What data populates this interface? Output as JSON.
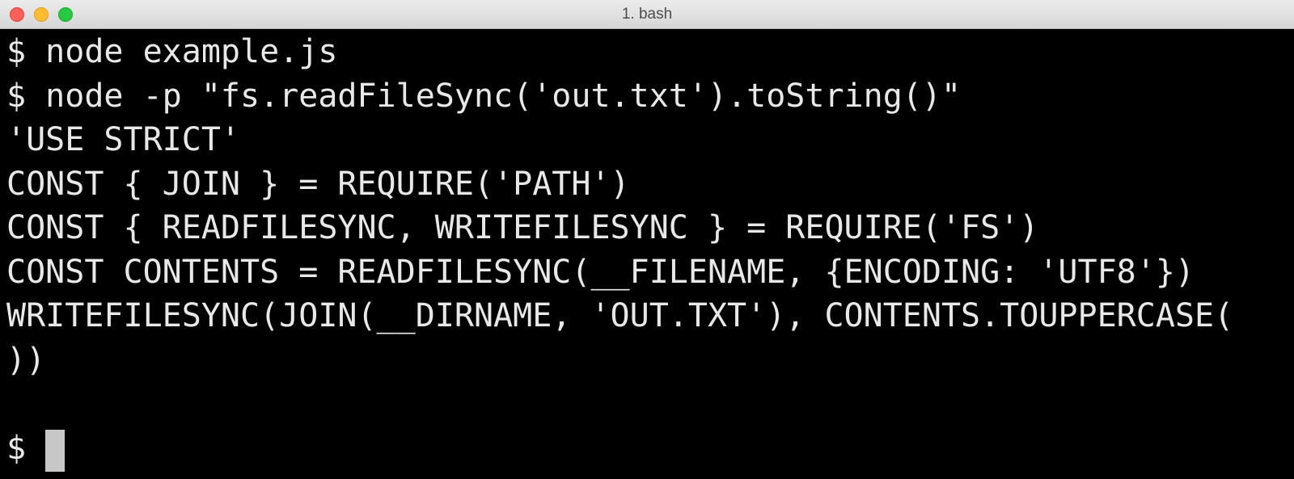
{
  "window": {
    "title": "1. bash"
  },
  "terminal": {
    "lines": [
      "$ node example.js",
      "$ node -p \"fs.readFileSync('out.txt').toString()\"",
      "'USE STRICT'",
      "CONST { JOIN } = REQUIRE('PATH')",
      "CONST { READFILESYNC, WRITEFILESYNC } = REQUIRE('FS')",
      "CONST CONTENTS = READFILESYNC(__FILENAME, {ENCODING: 'UTF8'})",
      "WRITEFILESYNC(JOIN(__DIRNAME, 'OUT.TXT'), CONTENTS.TOUPPERCASE(",
      "))",
      ""
    ],
    "prompt": "$ "
  },
  "colors": {
    "background": "#000000",
    "text": "#e8e8e8",
    "cursor": "#c7c7c7",
    "close": "#fe5f57",
    "minimize": "#febc2e",
    "zoom": "#28c840"
  }
}
